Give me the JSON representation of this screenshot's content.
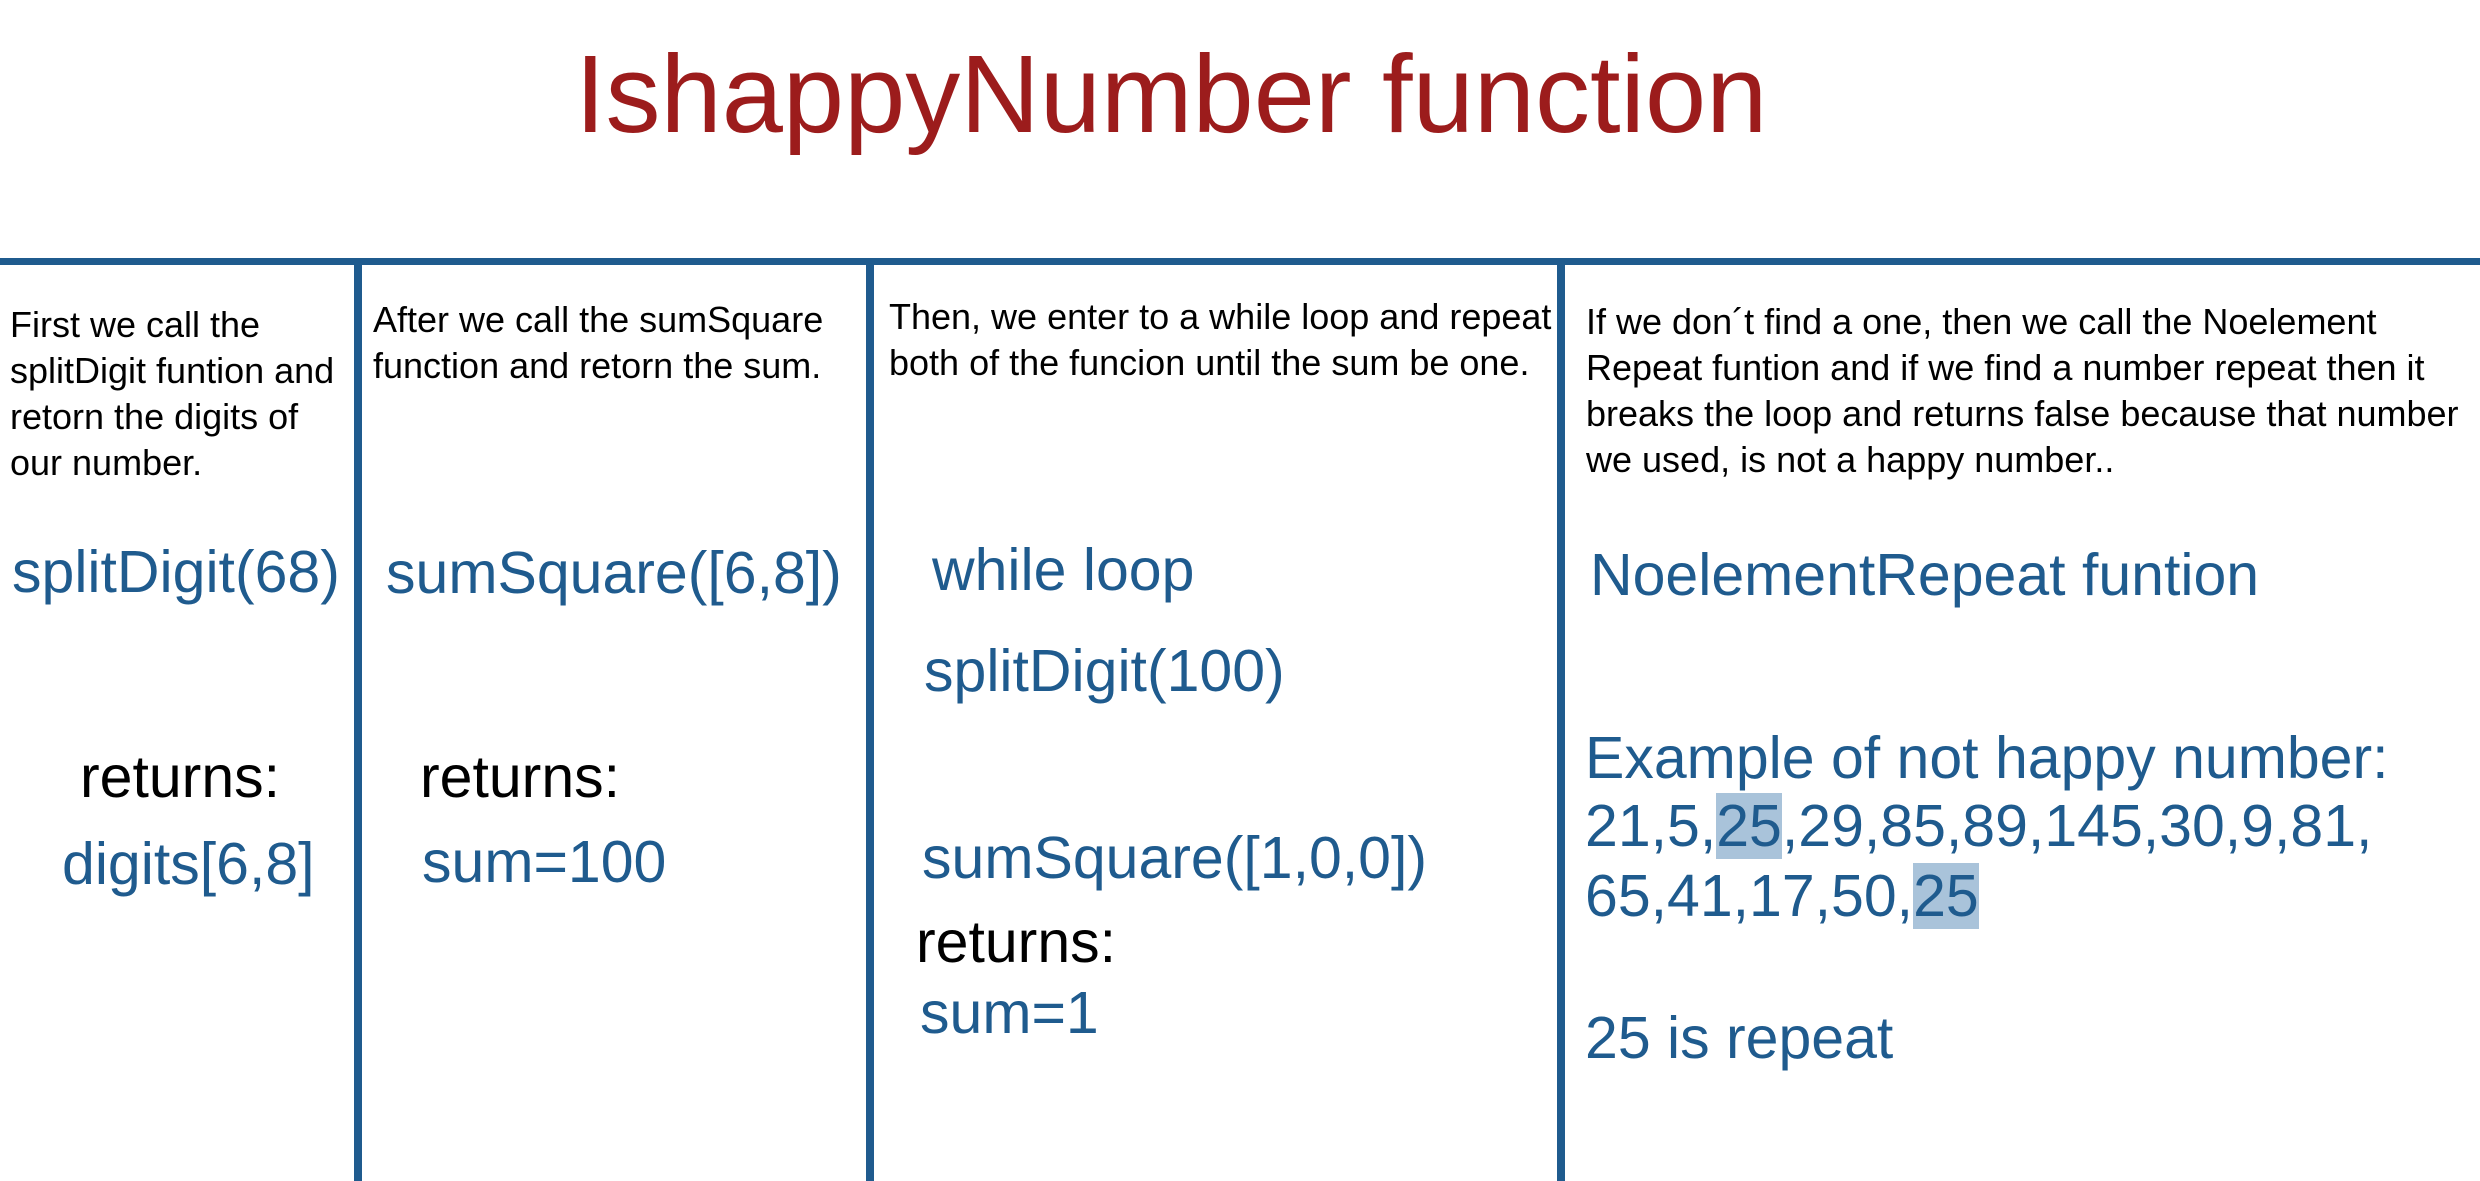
{
  "title": "IshappyNumber function",
  "colors": {
    "title": "#9c1c1c",
    "accent": "#1f5b8e",
    "highlight": "#a9c3da"
  },
  "col1": {
    "description": "First we call the splitDigit funtion and retorn the digits of our number.",
    "call": "splitDigit(68)",
    "returns_label": "returns:",
    "result": "digits[6,8]"
  },
  "col2": {
    "description": "After we call the sumSquare function and retorn the sum.",
    "call": "sumSquare([6,8])",
    "returns_label": "returns:",
    "result": "sum=100"
  },
  "col3": {
    "description": "Then, we enter to a while loop and repeat both of the funcion until the sum be one.",
    "loop": "while loop",
    "call1": "splitDigit(100)",
    "call2": "sumSquare([1,0,0])",
    "returns_label": "returns:",
    "result": "sum=1"
  },
  "col4": {
    "description": "If we don´t find a one, then we call the Noelement Repeat funtion and if we find a number repeat then it breaks the loop and returns false because that number we used, is not a happy number..",
    "heading": "NoelementRepeat funtion",
    "example_label": "Example of not happy number:",
    "seq_line1_prefix": "21,5,",
    "seq_line1_highlight": "25",
    "seq_line1_suffix": ",29,85,89,145,30,9,81,",
    "seq_line2_prefix": "65,41,17,50,",
    "seq_line2_highlight": "25",
    "conclusion": "25 is repeat"
  }
}
